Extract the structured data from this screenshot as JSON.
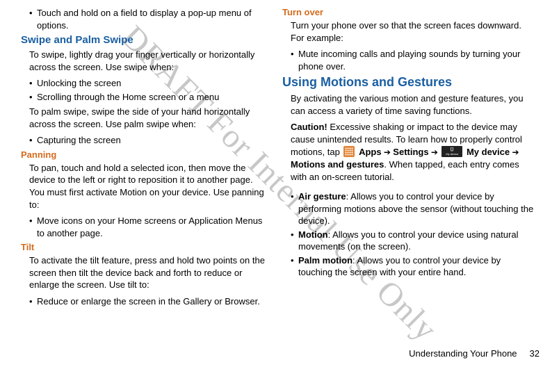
{
  "watermark": "DRAFT For Internal Use Only",
  "footer": {
    "section": "Understanding Your Phone",
    "page": "32"
  },
  "left": {
    "top_bullet": "Touch and hold on a field to display a pop-up menu of options.",
    "swipe_heading": "Swipe and Palm Swipe",
    "swipe_intro": "To swipe, lightly drag your finger vertically or horizontally across the screen. Use swipe when:",
    "swipe_bullets": [
      "Unlocking the screen",
      "Scrolling through the Home screen or a menu"
    ],
    "palm_intro": "To palm swipe, swipe the side of your hand horizontally across the screen. Use palm swipe when:",
    "palm_bullets": [
      "Capturing the screen"
    ],
    "pan_heading": "Panning",
    "pan_intro": "To pan, touch and hold a selected icon, then move the device to the left or right to reposition it to another page. You must first activate Motion on your device. Use panning to:",
    "pan_bullets": [
      "Move icons on your Home screens or Application Menus to another page."
    ],
    "tilt_heading": "Tilt",
    "tilt_intro": "To activate the tilt feature, press and hold two points on the screen then tilt the device back and forth to reduce or enlarge the screen. Use tilt to:",
    "tilt_bullets": [
      "Reduce or enlarge the screen in the Gallery or Browser."
    ]
  },
  "right": {
    "turn_heading": "Turn over",
    "turn_intro": "Turn your phone over so that the screen faces downward. For example:",
    "turn_bullets": [
      "Mute incoming calls and playing sounds by turning your phone over."
    ],
    "motions_heading": "Using Motions and Gestures",
    "motions_intro": "By activating the various motion and gesture features, you can access a variety of time saving functions.",
    "caution_label": "Caution!",
    "caution_pre": " Excessive shaking or impact to the device may cause unintended results. To learn how to properly control motions, tap ",
    "caution_apps": "Apps",
    "caution_arrow": " ➔ ",
    "caution_settings": "Settings",
    "caution_mydevice": "My device",
    "caution_mydevice_label": "My device",
    "caution_post1": " ➔ ",
    "caution_mag": "Motions and gestures",
    "caution_post2": ". When tapped, each entry comes with an on-screen tutorial.",
    "feat": {
      "air_label": "Air gesture",
      "air_text": ": Allows you to control your device by performing motions above the sensor (without touching the device).",
      "motion_label": "Motion",
      "motion_text": ": Allows you to control your device using natural movements (on the screen).",
      "palm_label": "Palm motion",
      "palm_text": ": Allows you to control your device by touching the screen with your entire hand."
    }
  }
}
